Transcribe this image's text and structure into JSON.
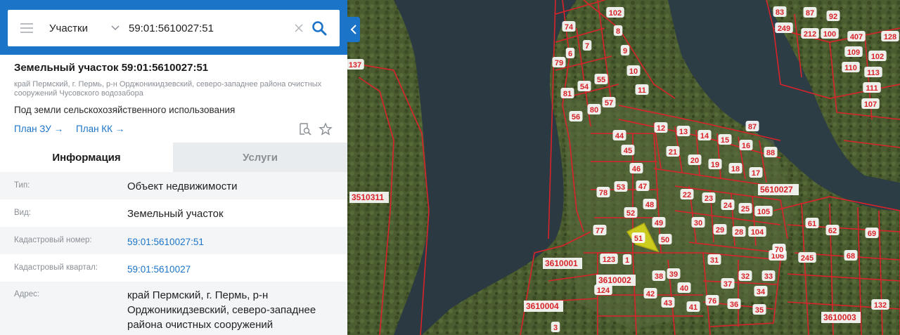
{
  "search": {
    "type_label": "Участки",
    "query": "59:01:5610027:51"
  },
  "object": {
    "title": "Земельный участок 59:01:5610027:51",
    "address_short": "край Пермский, г. Пермь, р-н Орджоникидзевский, северо-западнее района очистных сооружений Чусовского водозабора",
    "usage": "Под земли сельскохозяйственного использования",
    "plan_zu": "План ЗУ →",
    "plan_kk": "План КК →"
  },
  "tabs": {
    "info": "Информация",
    "services": "Услуги"
  },
  "info": {
    "type_label": "Тип:",
    "type_value": "Объект недвижимости",
    "kind_label": "Вид:",
    "kind_value": "Земельный участок",
    "cad_num_label": "Кадастровый номер:",
    "cad_num_value": "59:01:5610027:51",
    "cad_block_label": "Кадастровый квартал:",
    "cad_block_value": "59:01:5610027",
    "address_label": "Адрес:",
    "address_value": "край Пермский, г. Пермь, р-н Орджоникидзевский, северо-западнее района очистных сооружений"
  },
  "map": {
    "quarter_labels": [
      "3510311",
      "5610027",
      "3610001",
      "3610002",
      "3610004",
      "3610003"
    ],
    "parcel_labels": [
      "102",
      "8",
      "9",
      "10",
      "11",
      "74",
      "7",
      "6",
      "79",
      "81",
      "54",
      "55",
      "56",
      "80",
      "57",
      "12",
      "13",
      "14",
      "15",
      "16",
      "87",
      "88",
      "44",
      "45",
      "46",
      "47",
      "48",
      "49",
      "50",
      "53",
      "52",
      "78",
      "77",
      "21",
      "20",
      "19",
      "18",
      "17",
      "22",
      "23",
      "24",
      "25",
      "105",
      "104",
      "28",
      "29",
      "30",
      "31",
      "32",
      "33",
      "34",
      "35",
      "36",
      "37",
      "38",
      "39",
      "40",
      "41",
      "42",
      "43",
      "76",
      "106",
      "70",
      "61",
      "62",
      "245",
      "68",
      "69",
      "132",
      "123",
      "124",
      "83",
      "87",
      "92",
      "249",
      "212",
      "100",
      "407",
      "109",
      "102",
      "110",
      "113",
      "111",
      "107",
      "128",
      "3",
      "1",
      "51",
      "137"
    ],
    "selected_parcel": "51",
    "colors": {
      "boundary": "#d8232a",
      "selected_fill": "#d6d51c",
      "water": "#2b3b43",
      "vegetation": "#4b5e31"
    }
  }
}
